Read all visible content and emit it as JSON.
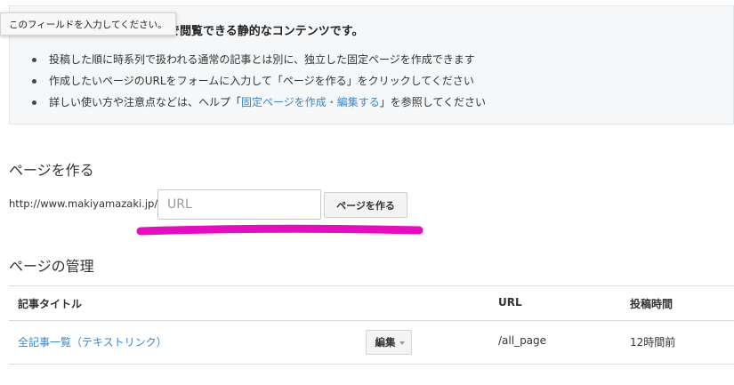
{
  "tooltip": {
    "text": "このフィールドを入力してください。"
  },
  "info": {
    "title_visible": "ムで閲覧できる静的なコンテンツです。",
    "items": [
      "投稿した順に時系列で扱われる通常の記事とは別に、独立した固定ページを作成できます",
      "作成したいページのURLをフォームに入力して「ページを作る」をクリックしてください"
    ],
    "help_item": {
      "before": "詳しい使い方や注意点などは、ヘルプ「",
      "link": "固定ページを作成・編集する",
      "after": "」を参照してください"
    }
  },
  "create_page": {
    "heading": "ページを作る",
    "url_prefix": "http://www.makiyamazaki.jp/",
    "input_placeholder": "URL",
    "input_value": "",
    "button_label": "ページを作る",
    "highlight_color": "#e30fbf"
  },
  "manage_pages": {
    "heading": "ページの管理",
    "columns": {
      "title": "記事タイトル",
      "url": "URL",
      "time": "投稿時間"
    },
    "rows": [
      {
        "title": "全記事一覧（テキストリンク）",
        "edit_label": "編集",
        "url": "/all_page",
        "time": "12時間前"
      }
    ]
  },
  "colors": {
    "link": "#3a87c8",
    "info_background": "#f5f7f9"
  }
}
